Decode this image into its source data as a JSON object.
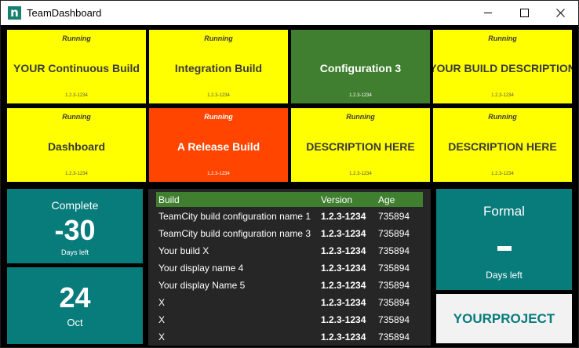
{
  "window": {
    "title": "TeamDashboard",
    "icon_letter": "n"
  },
  "builds": [
    {
      "status": "Running",
      "name": "YOUR Continuous Build",
      "version": "1.2.3-1234",
      "color": "#ffff00"
    },
    {
      "status": "Running",
      "name": "Integration Build",
      "version": "1.2.3-1234",
      "color": "#ffff00"
    },
    {
      "status": "",
      "name": "Configuration 3",
      "version": "1.2.3-1234",
      "color": "#3f7f2f"
    },
    {
      "status": "Running",
      "name": "YOUR BUILD DESCRIPTION",
      "version": "1.2.3-1234",
      "color": "#ffff00"
    },
    {
      "status": "Running",
      "name": "Dashboard",
      "version": "1.2.3-1234",
      "color": "#ffff00"
    },
    {
      "status": "Running",
      "name": "A Release Build",
      "version": "1.2.3-1234",
      "color": "#ff4500"
    },
    {
      "status": "Running",
      "name": "DESCRIPTION HERE",
      "version": "1.2.3-1234",
      "color": "#ffff00"
    },
    {
      "status": "Running",
      "name": "DESCRIPTION HERE",
      "version": "1.2.3-1234",
      "color": "#ffff00"
    }
  ],
  "countdown": {
    "label": "Complete",
    "value": "-30",
    "unit": "Days left"
  },
  "date": {
    "day": "24",
    "month": "Oct"
  },
  "build_list": {
    "columns": [
      "Build",
      "Version",
      "Age"
    ],
    "rows": [
      {
        "build": "TeamCity build configuration name 1",
        "version": "1.2.3-1234",
        "age": "735894"
      },
      {
        "build": "TeamCity build configuration name 3",
        "version": "1.2.3-1234",
        "age": "735894"
      },
      {
        "build": "Your build X",
        "version": "1.2.3-1234",
        "age": "735894"
      },
      {
        "build": "Your display name 4",
        "version": "1.2.3-1234",
        "age": "735894"
      },
      {
        "build": "Your display Name 5",
        "version": "1.2.3-1234",
        "age": "735894"
      },
      {
        "build": "X",
        "version": "1.2.3-1234",
        "age": "735894"
      },
      {
        "build": "X",
        "version": "1.2.3-1234",
        "age": "735894"
      },
      {
        "build": "X",
        "version": "1.2.3-1234",
        "age": "735894"
      }
    ]
  },
  "formal": {
    "label": "Formal",
    "value": "-",
    "unit": "Days left"
  },
  "project": {
    "name": "YOURPROJECT"
  },
  "colors": {
    "teal": "#087b7b",
    "yellow": "#ffff00",
    "green": "#3f7f2f",
    "red": "#ff4500"
  }
}
